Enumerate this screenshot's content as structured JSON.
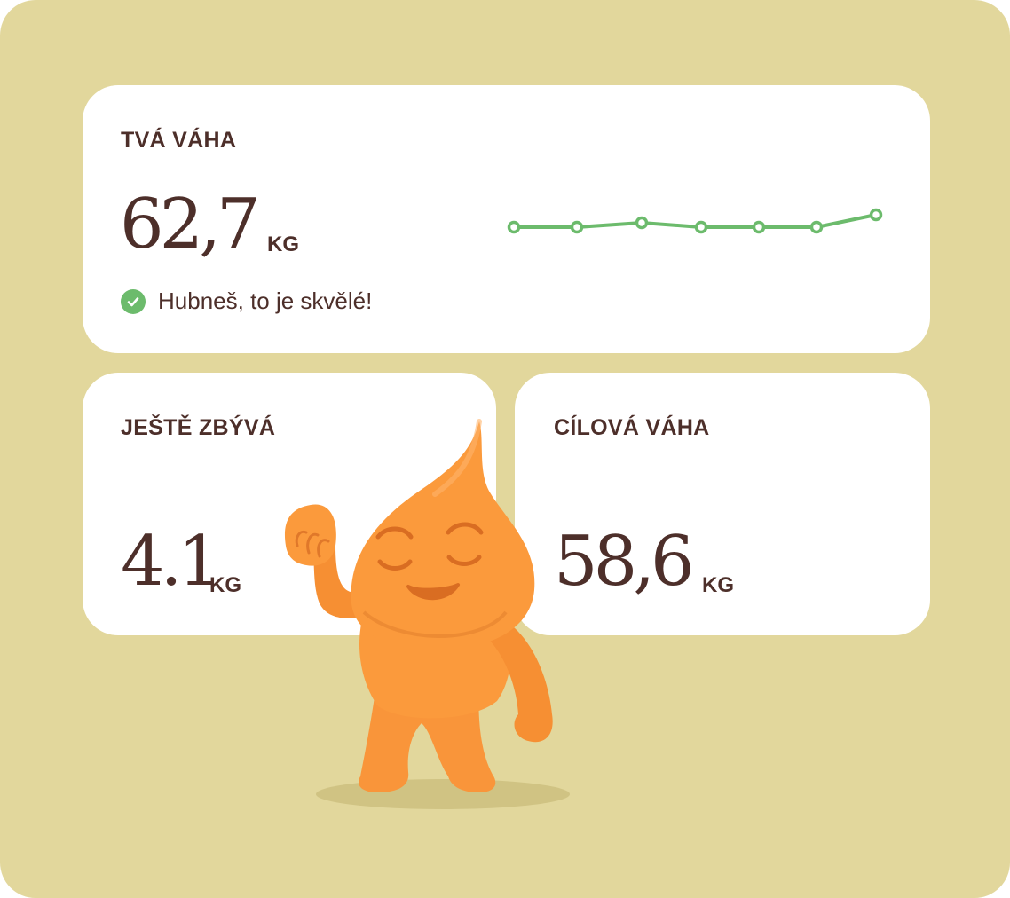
{
  "current": {
    "label": "TVÁ VÁHA",
    "value": "62,7",
    "unit": "KG",
    "status_text": "Hubneš, to je skvělé!",
    "status_icon": "check-circle-icon",
    "trend": [
      268,
      268,
      263,
      268,
      268,
      268,
      254
    ]
  },
  "remaining": {
    "label": "JEŠTĚ ZBÝVÁ",
    "value": "4.1",
    "unit": "KG"
  },
  "goal": {
    "label": "CÍLOVÁ VÁHA",
    "value": "58,6",
    "unit": "KG"
  },
  "colors": {
    "background": "#e2d79c",
    "card": "#ffffff",
    "text": "#4d2f2a",
    "accent_green": "#6cbb6c",
    "mascot": "#fb9a3c"
  },
  "mascot": "orange-drop-mascot"
}
